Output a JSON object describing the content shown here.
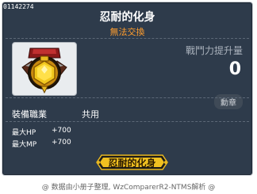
{
  "item": {
    "id": "01142274",
    "name": "忍耐的化身",
    "trade_status": "無法交換",
    "icon": "gold-medal-icon",
    "combat_power_label": "戰鬥力提升量",
    "combat_power_value": "0",
    "category_badge": "勳章",
    "job_label": "裝備職業",
    "job_value": "共用",
    "stats": [
      {
        "label": "最大HP",
        "value": "+700"
      },
      {
        "label": "最大MP",
        "value": "+700"
      }
    ],
    "medal_tag": "忍耐的化身"
  },
  "footer": "@ 数据由小册子整理, WzComparerR2-NTMS解析 @",
  "colors": {
    "panel_bg": "#2e3b4b",
    "trade_status": "#ff9d2e",
    "medal_gold": "#e8b820"
  }
}
